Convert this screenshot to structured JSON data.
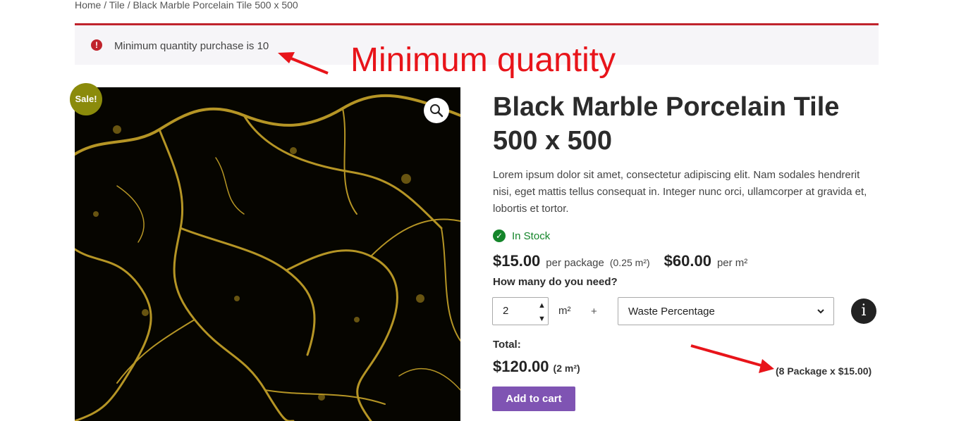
{
  "breadcrumb": "Home / Tile / Black Marble Porcelain Tile 500 x 500",
  "notice": {
    "icon": "error-icon",
    "text": "Minimum quantity purchase is 10"
  },
  "annotation": {
    "text": "Minimum quantity",
    "color": "#e8141a"
  },
  "gallery": {
    "sale_badge": "Sale!",
    "zoom_icon": "magnifier-icon"
  },
  "product": {
    "title_line1": "Black Marble Porcelain Tile",
    "title_line2": "500 x 500",
    "description": "Lorem ipsum dolor sit amet, consectetur adipiscing elit. Nam sodales hendrerit nisi, eget mattis tellus consequat in. Integer nunc orci, ullamcorper at gravida et, lobortis et tortor.",
    "stock": "In Stock",
    "price": "$15.00",
    "price_unit": "per package",
    "package_size": "(0.25 m²)",
    "price_per_m2": "$60.00",
    "price_per_m2_unit": "per m²"
  },
  "calculator": {
    "question": "How many do you need?",
    "quantity": "2",
    "unit": "m²",
    "plus": "+",
    "waste_selected": "Waste Percentage",
    "info_label": "i"
  },
  "total": {
    "label": "Total:",
    "price": "$120.00",
    "area": "(2 m²)",
    "package_calc": "(8 Package x $15.00)"
  },
  "add_to_cart": "Add to cart",
  "colors": {
    "accent_purple": "#7f54b3",
    "error_red": "#c0232c",
    "stock_green": "#14852a",
    "sale_olive": "#8b8b0b"
  }
}
